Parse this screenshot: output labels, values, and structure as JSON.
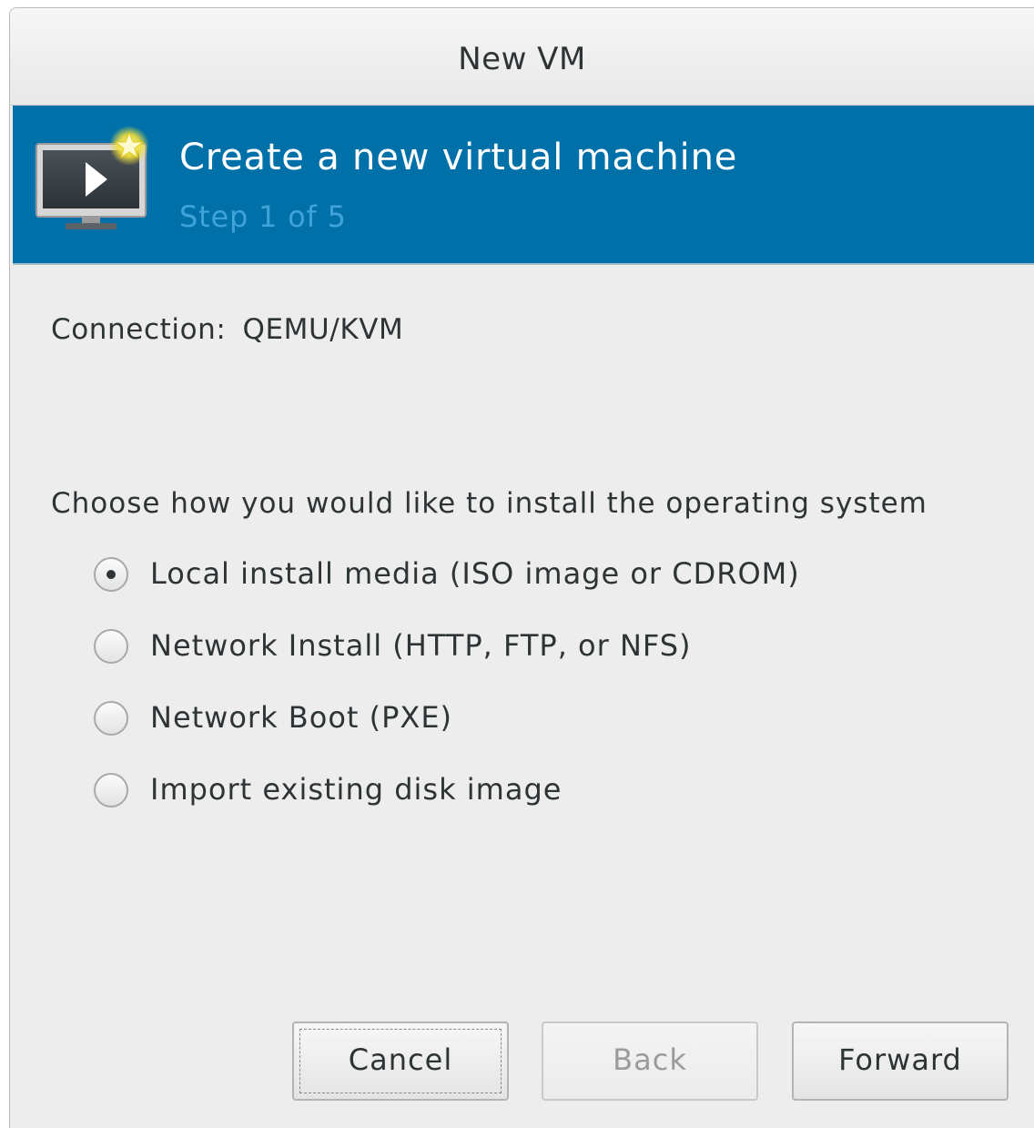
{
  "window": {
    "title": "New VM"
  },
  "banner": {
    "title": "Create a new virtual machine",
    "subtitle": "Step 1 of 5",
    "icon": "vm-monitor-icon",
    "colors": {
      "background": "#0070a8",
      "subtitle": "#3fa3d8"
    }
  },
  "connection": {
    "label": "Connection:",
    "value": "QEMU/KVM"
  },
  "install": {
    "prompt": "Choose how you would like to install the operating system",
    "options": [
      {
        "label": "Local install media (ISO image or CDROM)",
        "selected": true
      },
      {
        "label": "Network Install (HTTP, FTP, or NFS)",
        "selected": false
      },
      {
        "label": "Network Boot (PXE)",
        "selected": false
      },
      {
        "label": "Import existing disk image",
        "selected": false
      }
    ]
  },
  "buttons": {
    "cancel": "Cancel",
    "back": "Back",
    "forward": "Forward"
  }
}
